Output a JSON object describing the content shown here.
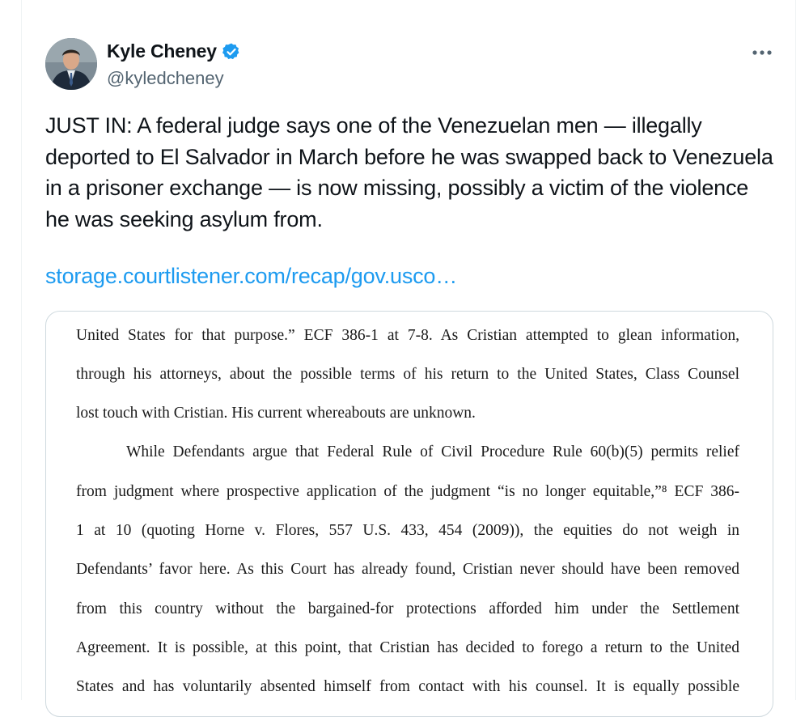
{
  "author": {
    "display_name": "Kyle Cheney",
    "handle": "@kyledcheney",
    "verified": true
  },
  "more_label": "···",
  "tweet": {
    "text": "JUST IN: A federal judge says one of the Venezuelan men — illegally deported to El Salvador in March before he was swapped back to Venezuela in a prisoner exchange — is now missing, possibly a victim of the violence he was seeking asylum from.",
    "link_text": "storage.courtlistener.com/recap/gov.usco…"
  },
  "document": {
    "lines": [
      "United States for that purpose.” ECF 386-1 at 7-8. As Cristian attempted to glean information,",
      "through his attorneys, about the possible terms of his return to the United States, Class Counsel",
      "lost touch with Cristian. His current whereabouts are unknown.",
      "While Defendants argue that Federal Rule of Civil Procedure Rule 60(b)(5) permits relief",
      "from judgment where prospective application of the judgment “is no longer equitable,”⁸ ECF 386-",
      "1 at 10 (quoting Horne v. Flores, 557 U.S. 433, 454 (2009)), the equities do not weigh in",
      "Defendants’ favor here. As this Court has already found, Cristian never should have been removed",
      "from this country without the bargained-for protections afforded him under the Settlement",
      "Agreement. It is possible, at this point, that Cristian has decided to forego a return to the United",
      "States and has voluntarily absented himself from contact with his counsel. It is equally possible"
    ]
  },
  "colors": {
    "text": "#0f1419",
    "secondary": "#536471",
    "link": "#1d9bf0",
    "verified_badge": "#1d9bf0",
    "border": "#cfd9de"
  },
  "icons": {
    "verified": "verified-badge-icon",
    "more": "more-horizontal-icon"
  }
}
